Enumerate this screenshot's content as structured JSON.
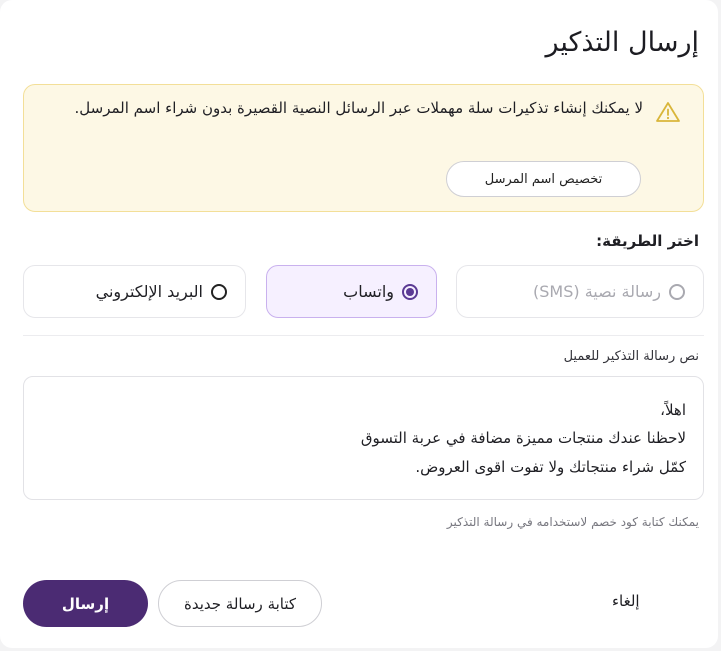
{
  "dialog": {
    "title": "إرسال التذكير"
  },
  "warning": {
    "icon": "warning-triangle-icon",
    "text": "لا يمكنك إنشاء تذكيرات سلة مهملات عبر الرسائل النصية القصيرة بدون شراء اسم المرسل.",
    "action_label": "تخصيص اسم المرسل"
  },
  "method": {
    "label": "اختر الطريقة:",
    "options": [
      {
        "label": "رسالة نصية (SMS)",
        "state": "disabled"
      },
      {
        "label": "واتساب",
        "state": "selected"
      },
      {
        "label": "البريد الإلكتروني",
        "state": "unselected"
      }
    ]
  },
  "message": {
    "label": "نص رسالة التذكير للعميل",
    "lines": [
      "اهلاً،",
      "لاحظنا عندك منتجات مميزة مضافة في عربة التسوق",
      "كمّل شراء منتجاتك ولا تفوت اقوى العروض."
    ],
    "hint": "يمكنك كتابة كود خصم لاستخدامه في رسالة التذكير"
  },
  "actions": {
    "cancel_label": "إلغاء",
    "new_message_label": "كتابة رسالة جديدة",
    "send_label": "إرسال"
  },
  "colors": {
    "primary": "#4b2b73",
    "warning_bg": "#fdf8e5",
    "warning_border": "#f3df98",
    "warning_icon": "#d9b63a",
    "selected_bg": "#f6f0ff"
  }
}
